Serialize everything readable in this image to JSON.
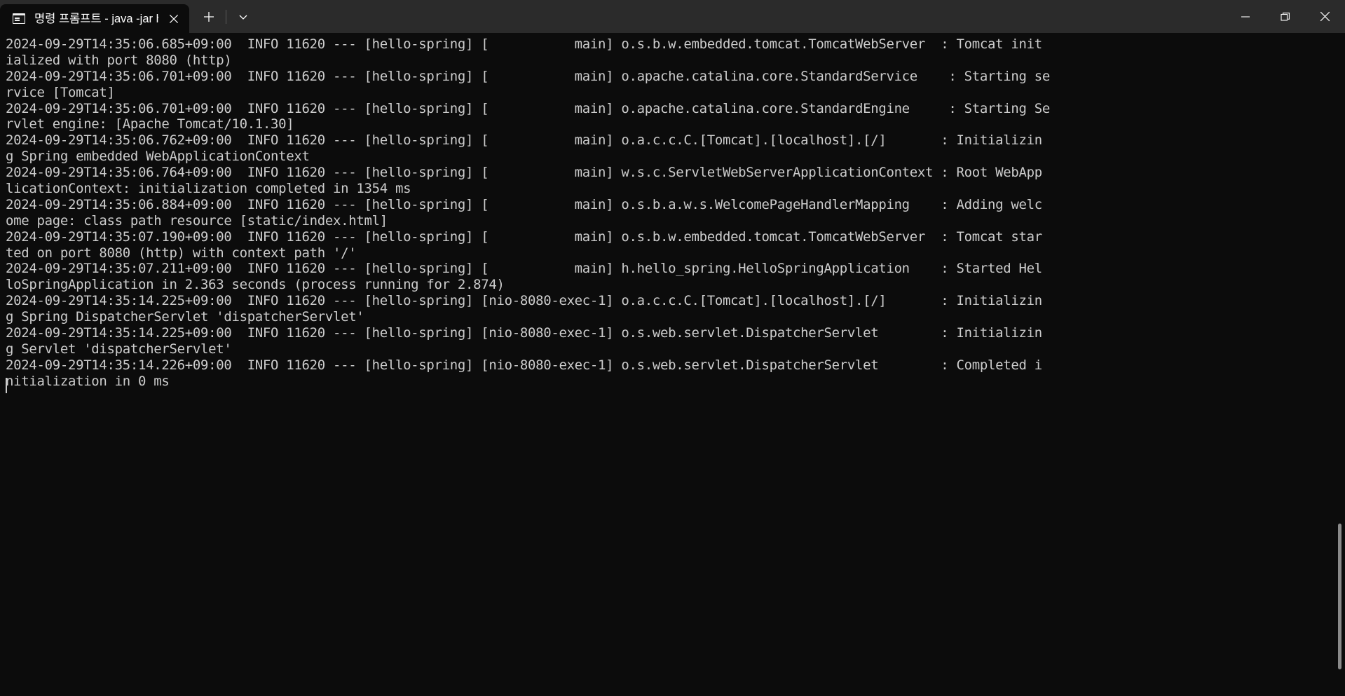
{
  "window": {
    "title": "명령 프롬프트 - java  -jar hello",
    "tab": {
      "icon": "command-prompt-icon",
      "label": "명령 프롬프트 - java  -jar hello",
      "close_label": "✕"
    },
    "new_tab_label": "+",
    "tab_dropdown_label": "⌄",
    "controls": {
      "minimize": "–",
      "restore": "❐",
      "close": "✕"
    },
    "colors": {
      "titlebar_bg": "#2b2b2b",
      "tab_active_bg": "#0c0c0c",
      "terminal_bg": "#0c0c0c",
      "terminal_fg": "#cccccc",
      "scrollbar_thumb": "#8a8a8a"
    }
  },
  "terminal": {
    "prompt_cursor_visible": true,
    "scrollbar": {
      "thumb_top_pct": 74,
      "thumb_height_pct": 22
    },
    "lines": [
      "2024-09-29T14:35:06.685+09:00  INFO 11620 --- [hello-spring] [           main] o.s.b.w.embedded.tomcat.TomcatWebServer  : Tomcat init",
      "ialized with port 8080 (http)",
      "2024-09-29T14:35:06.701+09:00  INFO 11620 --- [hello-spring] [           main] o.apache.catalina.core.StandardService    : Starting se",
      "rvice [Tomcat]",
      "2024-09-29T14:35:06.701+09:00  INFO 11620 --- [hello-spring] [           main] o.apache.catalina.core.StandardEngine     : Starting Se",
      "rvlet engine: [Apache Tomcat/10.1.30]",
      "2024-09-29T14:35:06.762+09:00  INFO 11620 --- [hello-spring] [           main] o.a.c.c.C.[Tomcat].[localhost].[/]       : Initializin",
      "g Spring embedded WebApplicationContext",
      "2024-09-29T14:35:06.764+09:00  INFO 11620 --- [hello-spring] [           main] w.s.c.ServletWebServerApplicationContext : Root WebApp",
      "licationContext: initialization completed in 1354 ms",
      "2024-09-29T14:35:06.884+09:00  INFO 11620 --- [hello-spring] [           main] o.s.b.a.w.s.WelcomePageHandlerMapping    : Adding welc",
      "ome page: class path resource [static/index.html]",
      "2024-09-29T14:35:07.190+09:00  INFO 11620 --- [hello-spring] [           main] o.s.b.w.embedded.tomcat.TomcatWebServer  : Tomcat star",
      "ted on port 8080 (http) with context path '/'",
      "2024-09-29T14:35:07.211+09:00  INFO 11620 --- [hello-spring] [           main] h.hello_spring.HelloSpringApplication    : Started Hel",
      "loSpringApplication in 2.363 seconds (process running for 2.874)",
      "2024-09-29T14:35:14.225+09:00  INFO 11620 --- [hello-spring] [nio-8080-exec-1] o.a.c.c.C.[Tomcat].[localhost].[/]       : Initializin",
      "g Spring DispatcherServlet 'dispatcherServlet'",
      "2024-09-29T14:35:14.225+09:00  INFO 11620 --- [hello-spring] [nio-8080-exec-1] o.s.web.servlet.DispatcherServlet        : Initializin",
      "g Servlet 'dispatcherServlet'",
      "2024-09-29T14:35:14.226+09:00  INFO 11620 --- [hello-spring] [nio-8080-exec-1] o.s.web.servlet.DispatcherServlet        : Completed i",
      "nitialization in 0 ms"
    ]
  }
}
